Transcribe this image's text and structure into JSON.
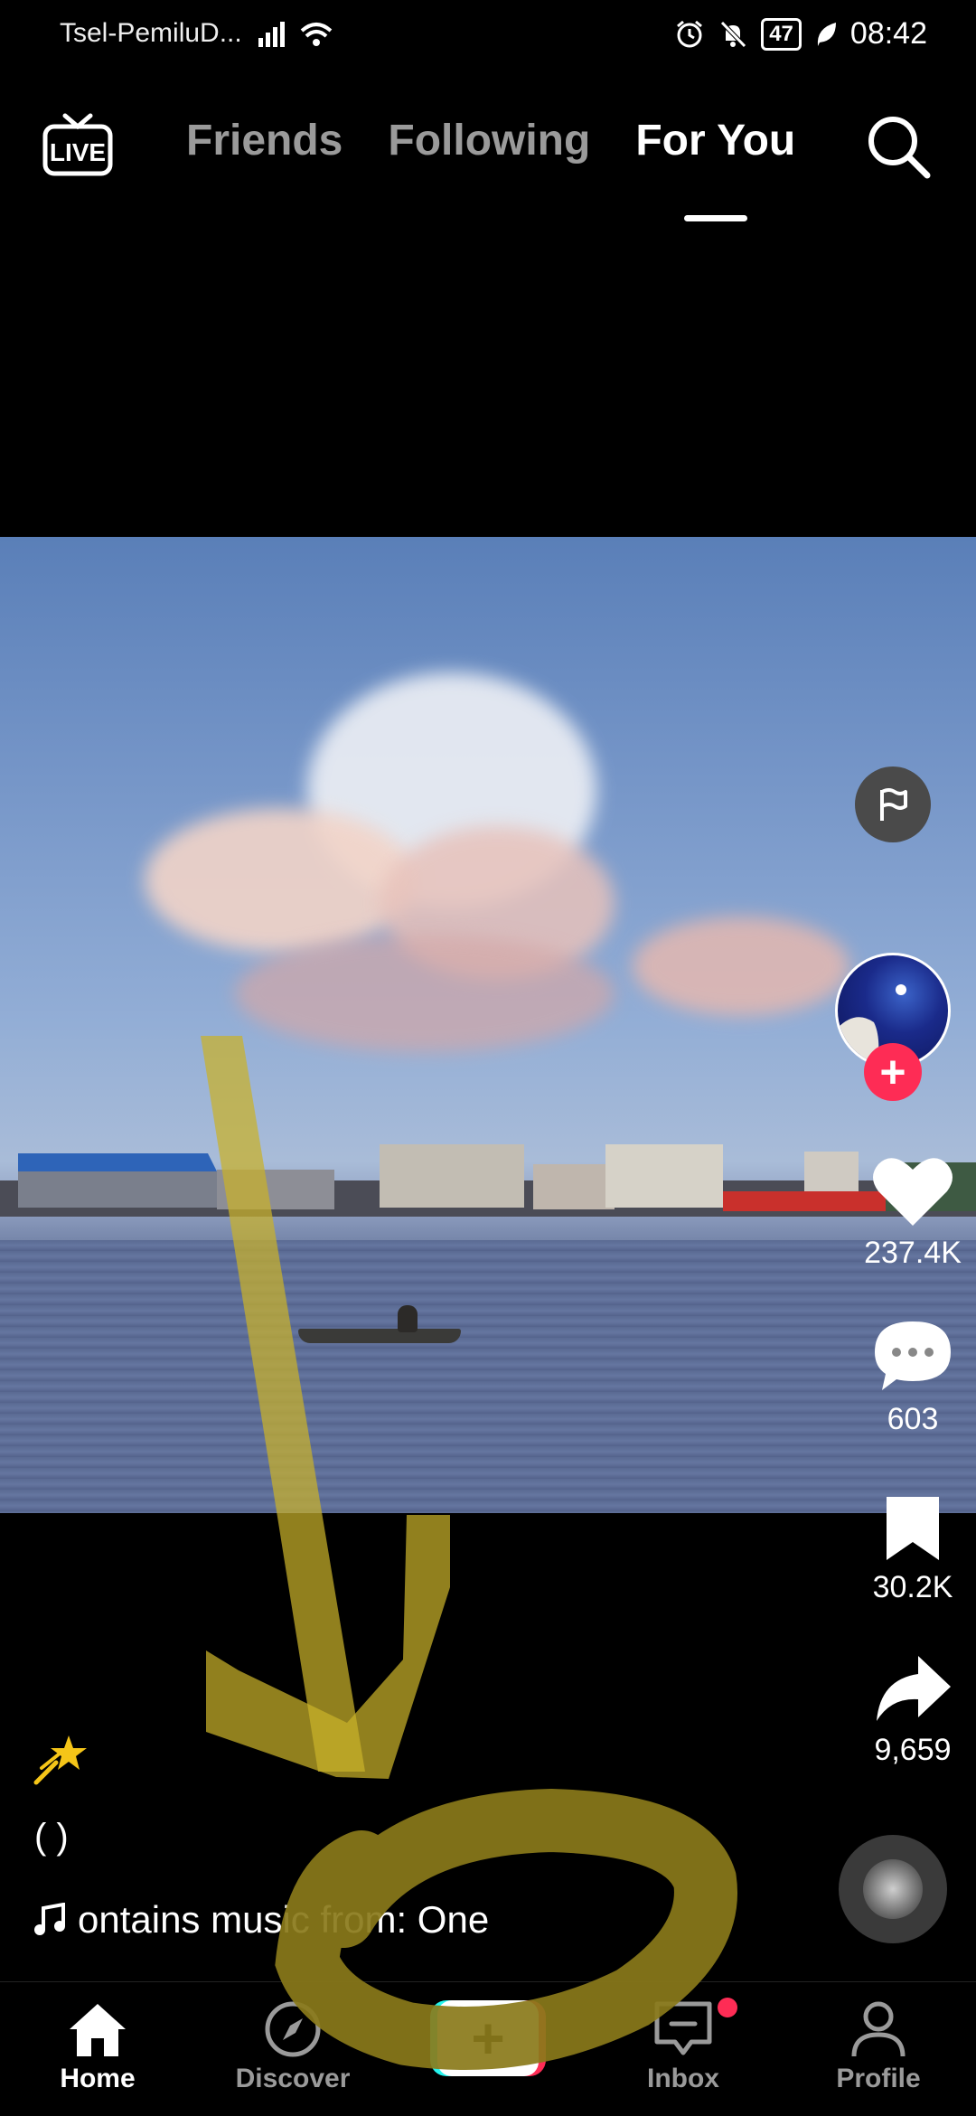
{
  "status_bar": {
    "carrier": "Tsel-PemiluD...",
    "battery": "47",
    "time": "08:42"
  },
  "top_nav": {
    "live_label": "LIVE",
    "tabs": [
      {
        "label": "Friends",
        "active": false
      },
      {
        "label": "Following",
        "active": false
      },
      {
        "label": "For You",
        "active": true
      }
    ]
  },
  "actions": {
    "likes": "237.4K",
    "comments": "603",
    "bookmarks": "30.2K",
    "shares": "9,659"
  },
  "caption": {
    "title": "(   )",
    "music": "ontains music from: One"
  },
  "bottom_nav": {
    "home": "Home",
    "discover": "Discover",
    "inbox": "Inbox",
    "profile": "Profile"
  },
  "colors": {
    "accent_red": "#fe2c55",
    "accent_cyan": "#25f4ee",
    "annotation": "#c9b22a"
  }
}
